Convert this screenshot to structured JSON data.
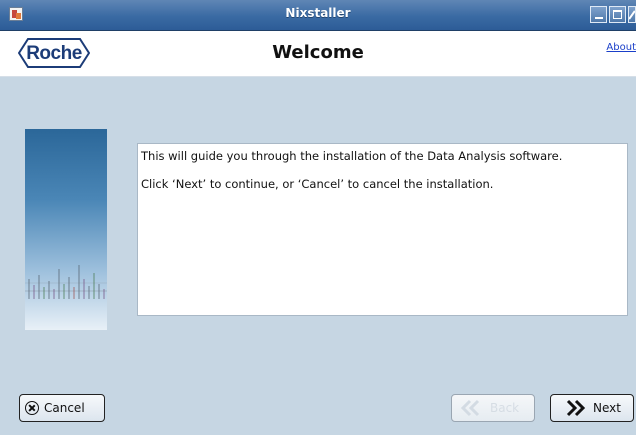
{
  "window": {
    "title": "Nixstaller"
  },
  "header": {
    "logo_text": "Roche",
    "page_title": "Welcome",
    "about_label": "About"
  },
  "content": {
    "line1": "This will guide you through the installation of the Data Analysis software.",
    "line2": "Click ‘Next’ to continue, or ‘Cancel’ to cancel the installation."
  },
  "buttons": {
    "cancel": "Cancel",
    "back": "Back",
    "next": "Next",
    "back_enabled": false
  },
  "icons": {
    "app": "nixstaller-icon",
    "minimize": "minimize-icon",
    "maximize": "maximize-icon",
    "close": "close-icon",
    "cancel": "circle-x-icon",
    "back": "double-chevron-left-icon",
    "next": "double-chevron-right-icon"
  },
  "colors": {
    "titlebar": "#3a6aa3",
    "background": "#c6d6e3",
    "logo": "#1c3c78",
    "link": "#1a3fc9"
  }
}
